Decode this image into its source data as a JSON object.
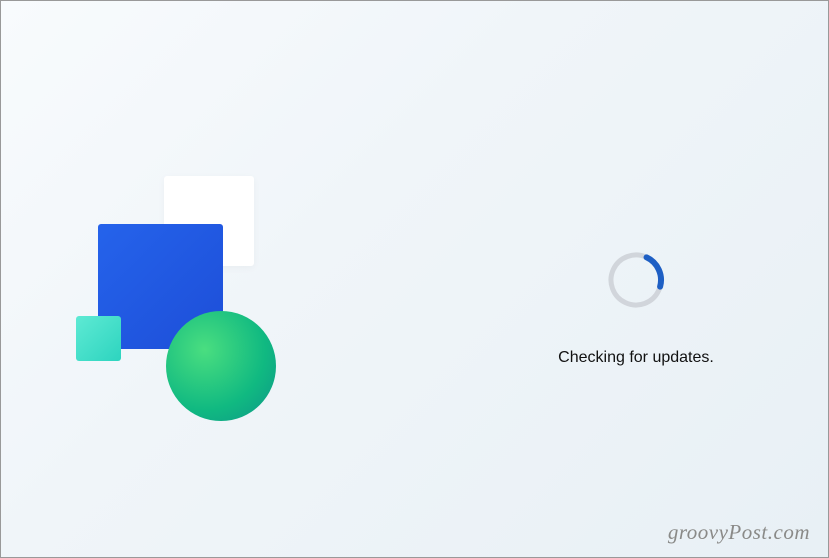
{
  "update": {
    "status_text": "Checking for updates."
  },
  "watermark": {
    "text": "groovyPost.com"
  },
  "icons": {
    "spinner": "loading-spinner-icon",
    "decor_white": "white-square-icon",
    "decor_blue": "blue-square-icon",
    "decor_teal_small": "teal-small-square-icon",
    "decor_teal_circle": "teal-circle-icon"
  },
  "colors": {
    "blue_square": "#1d4ed8",
    "teal_square": "#2dd4bf",
    "teal_circle": "#10b981",
    "spinner_fg": "#1e5fc4",
    "spinner_bg": "#d1d5db"
  }
}
